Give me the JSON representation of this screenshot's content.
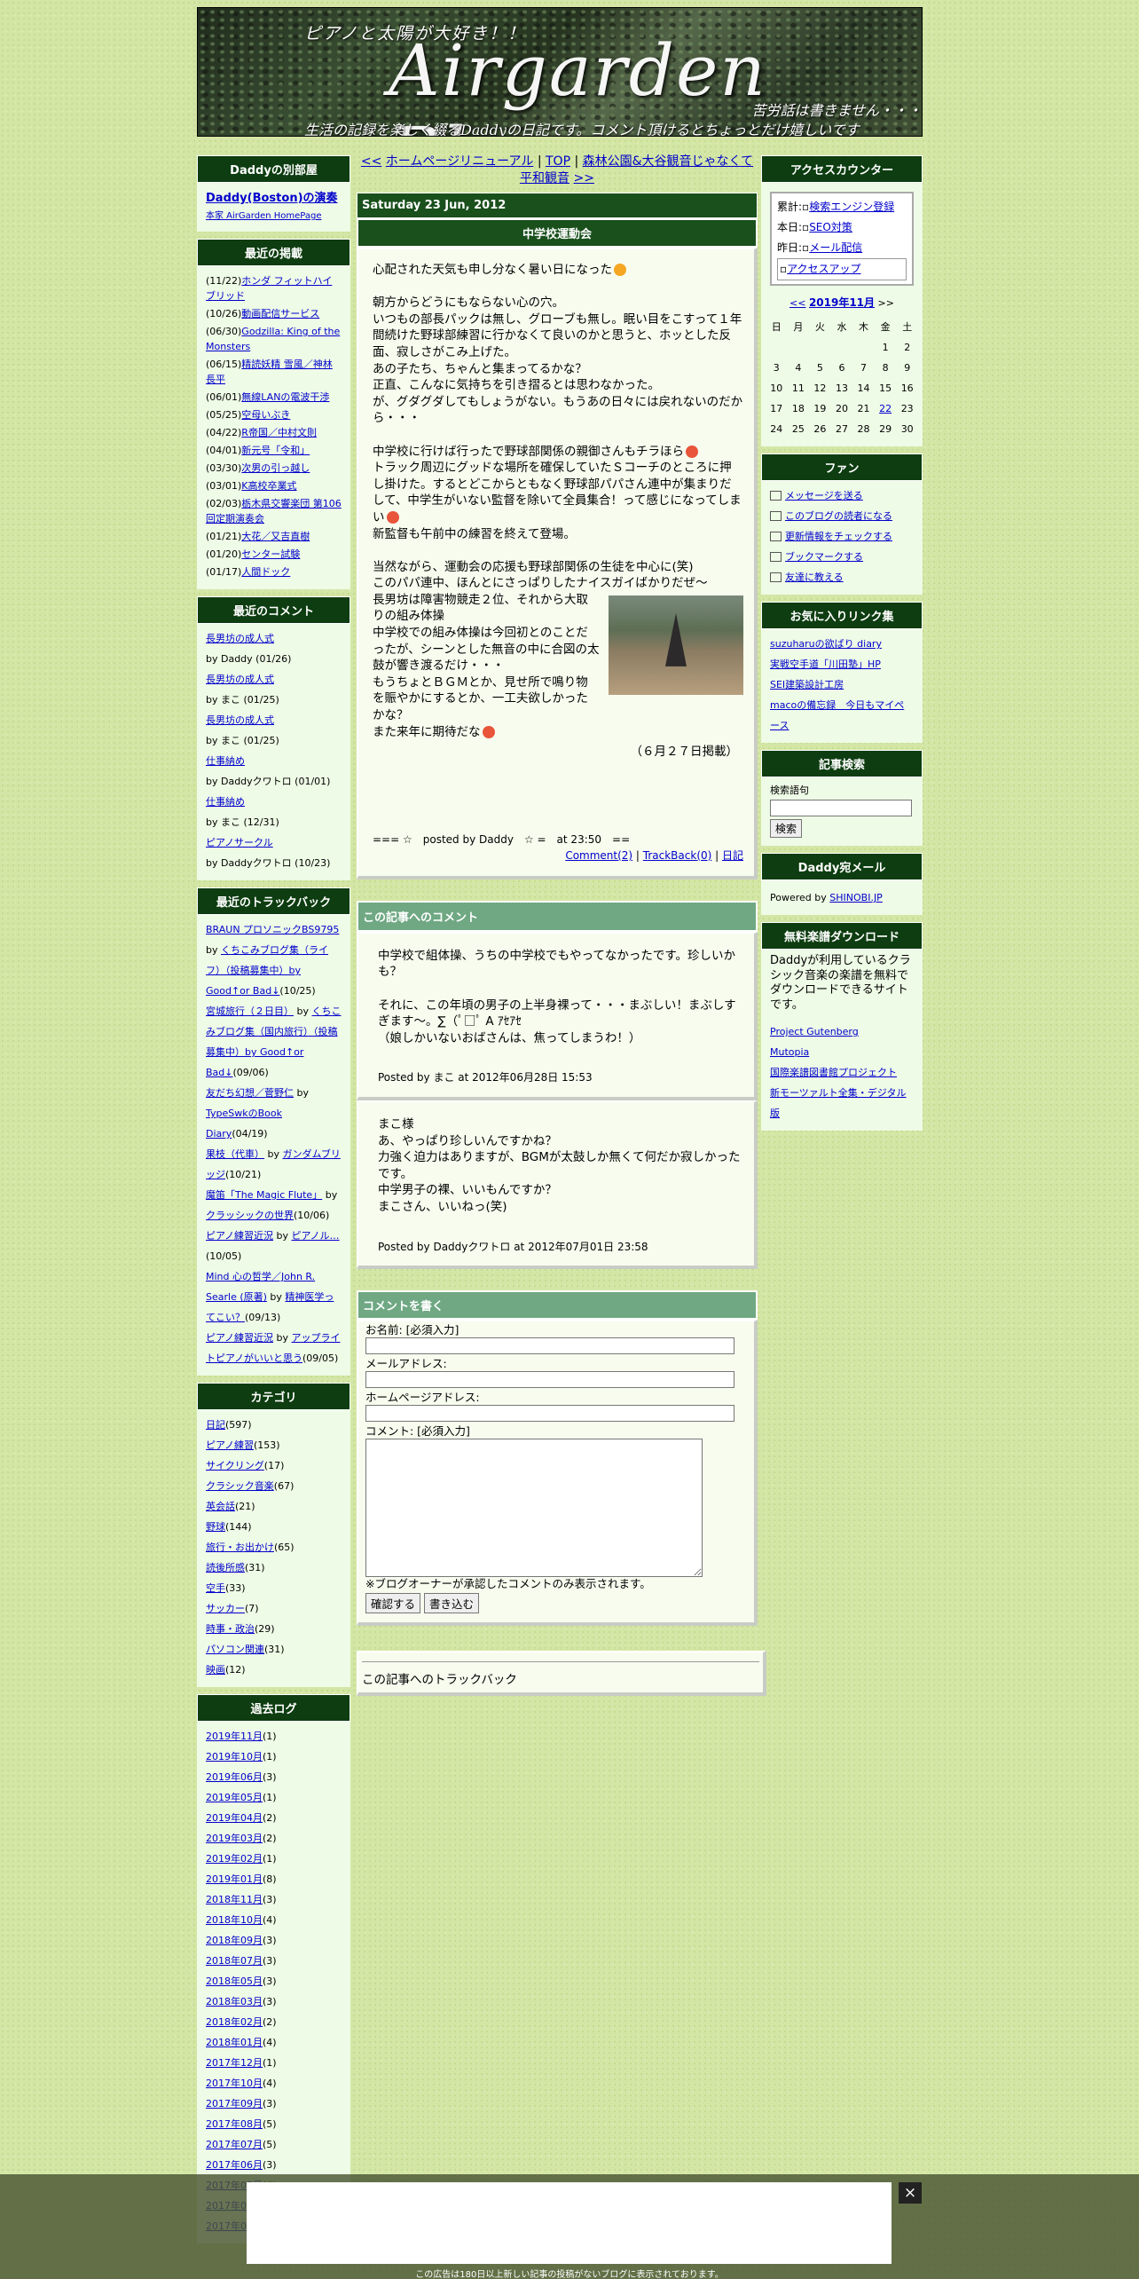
{
  "header": {
    "tagline": "ピアノと太陽が大好き！！",
    "logo": "Airgarden Blog",
    "right": "苦労話は書きません・・・",
    "subtitle": "生活の記録を楽しく綴るDaddyの日記です。コメント頂けるとちょっとだけ嬉しいです"
  },
  "left": {
    "betsu": {
      "title": "Daddyの別部屋",
      "link1": "Daddy(Boston)の演奏",
      "link2": "本家 AirGarden HomePage"
    },
    "recent": {
      "title": "最近の掲載",
      "items": [
        {
          "date": "(11/22)",
          "text": "ホンダ フィットハイブリッド"
        },
        {
          "date": "(10/26)",
          "text": "動画配信サービス"
        },
        {
          "date": "(06/30)",
          "text": "Godzilla: King of the Monsters"
        },
        {
          "date": "(06/15)",
          "text": "精読妖精 雪風／神林長平"
        },
        {
          "date": "(06/01)",
          "text": "無線LANの電波干渉"
        },
        {
          "date": "(05/25)",
          "text": "空母いぶき"
        },
        {
          "date": "(04/22)",
          "text": "R帝国／中村文則"
        },
        {
          "date": "(04/01)",
          "text": "新元号「令和」"
        },
        {
          "date": "(03/30)",
          "text": "次男の引っ越し"
        },
        {
          "date": "(03/01)",
          "text": "K高校卒業式"
        },
        {
          "date": "(02/03)",
          "text": "栃木県交響楽団 第106回定期演奏会"
        },
        {
          "date": "(01/21)",
          "text": "大花／又吉直樹"
        },
        {
          "date": "(01/20)",
          "text": "センター試験"
        },
        {
          "date": "(01/17)",
          "text": "人間ドック"
        }
      ]
    },
    "comments": {
      "title": "最近のコメント",
      "items": [
        {
          "link": "長男坊の成人式",
          "by": "by Daddy (01/26)"
        },
        {
          "link": "長男坊の成人式",
          "by": "by まこ (01/25)"
        },
        {
          "link": "長男坊の成人式",
          "by": "by まこ (01/25)"
        },
        {
          "link": "仕事納め",
          "by": "by Daddyクワトロ (01/01)"
        },
        {
          "link": "仕事納め",
          "by": "by まこ (12/31)"
        },
        {
          "link": "ピアノサークル",
          "by": "by Daddyクワトロ (10/23)"
        }
      ]
    },
    "trackback": {
      "title": "最近のトラックバック",
      "items": [
        {
          "l1": "BRAUN プロソニックBS9795",
          "by": " by ",
          "l2": "くちこみブログ集（ライフ）（投稿募集中）by Good↑or Bad↓",
          "d": "(10/25)"
        },
        {
          "l1": "宮城旅行（２日目）",
          "by": " by ",
          "l2": "くちこみブログ集（国内旅行）（投稿募集中）by Good↑or Bad↓",
          "d": "(09/06)"
        },
        {
          "l1": "友だち幻想／菅野仁",
          "by": " by ",
          "l2": "TypeSwkのBook Diary",
          "d": "(04/19)"
        },
        {
          "l1": "果枝（代車）",
          "by": " by ",
          "l2": "ガンダムブリッジ",
          "d": "(10/21)"
        },
        {
          "l1": "魔笛「The Magic Flute」",
          "by": " by ",
          "l2": "クラッシックの世界",
          "d": "(10/06)"
        },
        {
          "l1": "ピアノ練習近況",
          "by": " by ",
          "l2": "ピアノル…",
          "d": "(10/05)"
        },
        {
          "l1": "Mind 心の哲学／John R. Searle (原著)",
          "by": " by ",
          "l2": "精神医学ってこい？",
          "d": "(09/13)"
        },
        {
          "l1": "ピアノ練習近況",
          "by": " by ",
          "l2": "アップライトピアノがいいと思う",
          "d": "(09/05)"
        }
      ]
    },
    "category": {
      "title": "カテゴリ",
      "items": [
        {
          "name": "日記",
          "count": "(597)"
        },
        {
          "name": "ピアノ練習",
          "count": "(153)"
        },
        {
          "name": "サイクリング",
          "count": "(17)"
        },
        {
          "name": "クラシック音楽",
          "count": "(67)"
        },
        {
          "name": "英会話",
          "count": "(21)"
        },
        {
          "name": "野球",
          "count": "(144)"
        },
        {
          "name": "旅行・お出かけ",
          "count": "(65)"
        },
        {
          "name": "読後所感",
          "count": "(31)"
        },
        {
          "name": "空手",
          "count": "(33)"
        },
        {
          "name": "サッカー",
          "count": "(7)"
        },
        {
          "name": "時事・政治",
          "count": "(29)"
        },
        {
          "name": "パソコン関連",
          "count": "(31)"
        },
        {
          "name": "映画",
          "count": "(12)"
        }
      ]
    },
    "archive": {
      "title": "過去ログ",
      "items": [
        {
          "m": "2019年11月",
          "c": "(1)"
        },
        {
          "m": "2019年10月",
          "c": "(1)"
        },
        {
          "m": "2019年06月",
          "c": "(3)"
        },
        {
          "m": "2019年05月",
          "c": "(1)"
        },
        {
          "m": "2019年04月",
          "c": "(2)"
        },
        {
          "m": "2019年03月",
          "c": "(2)"
        },
        {
          "m": "2019年02月",
          "c": "(1)"
        },
        {
          "m": "2019年01月",
          "c": "(8)"
        },
        {
          "m": "2018年11月",
          "c": "(3)"
        },
        {
          "m": "2018年10月",
          "c": "(4)"
        },
        {
          "m": "2018年09月",
          "c": "(3)"
        },
        {
          "m": "2018年07月",
          "c": "(3)"
        },
        {
          "m": "2018年05月",
          "c": "(3)"
        },
        {
          "m": "2018年03月",
          "c": "(3)"
        },
        {
          "m": "2018年02月",
          "c": "(2)"
        },
        {
          "m": "2018年01月",
          "c": "(4)"
        },
        {
          "m": "2017年12月",
          "c": "(1)"
        },
        {
          "m": "2017年10月",
          "c": "(4)"
        },
        {
          "m": "2017年09月",
          "c": "(3)"
        },
        {
          "m": "2017年08月",
          "c": "(5)"
        },
        {
          "m": "2017年07月",
          "c": "(5)"
        },
        {
          "m": "2017年06月",
          "c": "(3)"
        },
        {
          "m": "2017年05月",
          "c": "(4)"
        },
        {
          "m": "2017年04月",
          "c": "(2)"
        },
        {
          "m": "2017年03月",
          "c": "(6)"
        }
      ]
    }
  },
  "main": {
    "nav": {
      "prev": "<<",
      "prev_title": "ホームページリニューアル",
      "sep1": " | ",
      "top": "TOP",
      "sep2": " | ",
      "next_title": "森林公園&大谷観音じゃなくて平和観音",
      "next": ">>"
    },
    "date": "Saturday 23 Jun, 2012",
    "title": "中学校運動会",
    "body": [
      "心配された天気も申し分なく暑い日になった",
      "",
      "朝方からどうにもならない心の穴。",
      "いつもの部長パックは無し、グローブも無し。眠い目をこすって１年間続けた野球部練習に行かなくて良いのかと思うと、ホッとした反面、寂しさがこみ上げた。",
      "あの子たち、ちゃんと集まってるかな？",
      "正直、こんなに気持ちを引き摺るとは思わなかった。",
      "が、グダグダしてもしょうがない。もうあの日々には戻れないのだから・・・",
      "",
      "中学校に行けば行ったで野球部関係の親御さんもチラほら",
      "トラック周辺にグッドな場所を確保していたＳコーチのところに押し掛けた。するとどこからともなく野球部パパさん連中が集まりだして、中学生がいない監督を除いて全員集合！って感じになってしまい",
      "新監督も午前中の練習を終えて登場。",
      "",
      "当然ながら、運動会の応援も野球部関係の生徒を中心に(笑)",
      "このパパ連中、ほんとにさっぱりしたナイスガイばかりだぜ～",
      "長男坊は障害物競走２位、それから大取りの組み体操",
      "中学校での組み体操は今回初とのことだったが、シーンとした無音の中に合図の太鼓が響き渡るだけ・・・",
      "もうちょとＢＧＭとか、見せ所で鳴り物を賑やかにするとか、一工夫欲しかったかな？",
      "また来年に期待だな"
    ],
    "published": "（６月２７日掲載）",
    "foot_left": "=== ☆　posted by Daddy　☆ =　at 23:50　==",
    "foot_comment": "Comment(2)",
    "foot_sep1": " | ",
    "foot_tb": "TrackBack(0)",
    "foot_sep2": " | ",
    "foot_cat": "日記",
    "comments_title": "この記事へのコメント",
    "comments": [
      {
        "text": [
          "中学校で組体操、うちの中学校でもやってなかったです。珍しいかも？",
          "",
          "それに、この年頃の男子の上半身裸って・・・まぶしい！まぶしすぎます～。∑（ﾟ□ﾟ A ｱｾｱｾ",
          "（娘しかいないおばさんは、焦ってしまうわ！）"
        ],
        "by": "Posted by まこ at 2012年06月28日 15:53"
      },
      {
        "text": [
          "まこ様",
          "あ、やっぱり珍しいんですかね？",
          "力強く迫力はありますが、BGMが太鼓しか無くて何だか寂しかったです。",
          "中学男子の裸、いいもんですか？",
          "まこさん、いいねっ(笑)"
        ],
        "by": "Posted by Daddyクワトロ at 2012年07月01日 23:58"
      }
    ],
    "form": {
      "title": "コメントを書く",
      "name": "お名前: [必須入力]",
      "mail": "メールアドレス:",
      "hp": "ホームページアドレス:",
      "comment": "コメント: [必須入力]",
      "note": "※ブログオーナーが承認したコメントのみ表示されます。",
      "confirm": "確認する",
      "clear": "書き込む"
    },
    "tb_title": "この記事へのトラックバック"
  },
  "right": {
    "counter": {
      "title": "アクセスカウンター",
      "r1l": "累計:",
      "r1v": "検索エンジン登録",
      "r2l": "本日:",
      "r2v": "SEO対策",
      "r3l": "昨日:",
      "r3v": "メール配信",
      "r4v": "アクセスアップ"
    },
    "calendar": {
      "prev": "<<",
      "month": "2019年11月",
      "next": ">>",
      "dow": [
        "日",
        "月",
        "火",
        "水",
        "木",
        "金",
        "土"
      ],
      "weeks": [
        [
          "",
          "",
          "",
          "",
          "",
          "1",
          "2"
        ],
        [
          "3",
          "4",
          "5",
          "6",
          "7",
          "8",
          "9"
        ],
        [
          "10",
          "11",
          "12",
          "13",
          "14",
          "15",
          "16"
        ],
        [
          "17",
          "18",
          "19",
          "20",
          "21",
          "22",
          "23"
        ],
        [
          "24",
          "25",
          "26",
          "27",
          "28",
          "29",
          "30"
        ]
      ]
    },
    "fan": {
      "title": "ファン",
      "items": [
        "メッセージを送る",
        "このブログの読者になる",
        "更新情報をチェックする",
        "ブックマークする",
        "友達に教える"
      ]
    },
    "links": {
      "title": "お気に入りリンク集",
      "items": [
        "suzuharuの欲ばり diary",
        "実戦空手道「川田塾」HP",
        "SEI建築設計工房",
        "macoの備忘録　今日もマイペース"
      ]
    },
    "search": {
      "title": "記事検索",
      "label": "検索語句",
      "button": "検索"
    },
    "mail": {
      "title": "Daddy宛メール",
      "powered": "Powered by ",
      "link": "SHINOBI.JP"
    },
    "free": {
      "title": "無料楽譜ダウンロード",
      "desc": "Daddyが利用しているクラシック音楽の楽譜を無料でダウンロードできるサイトです。",
      "items": [
        "Project Gutenberg",
        "Mutopia",
        "国際楽譜図書館プロジェクト",
        "新モーツァルト全集・デジタル版"
      ]
    }
  },
  "ad": {
    "close": "×",
    "note": "この広告は180日以上新しい記事の投稿がないブログに表示されております。"
  }
}
